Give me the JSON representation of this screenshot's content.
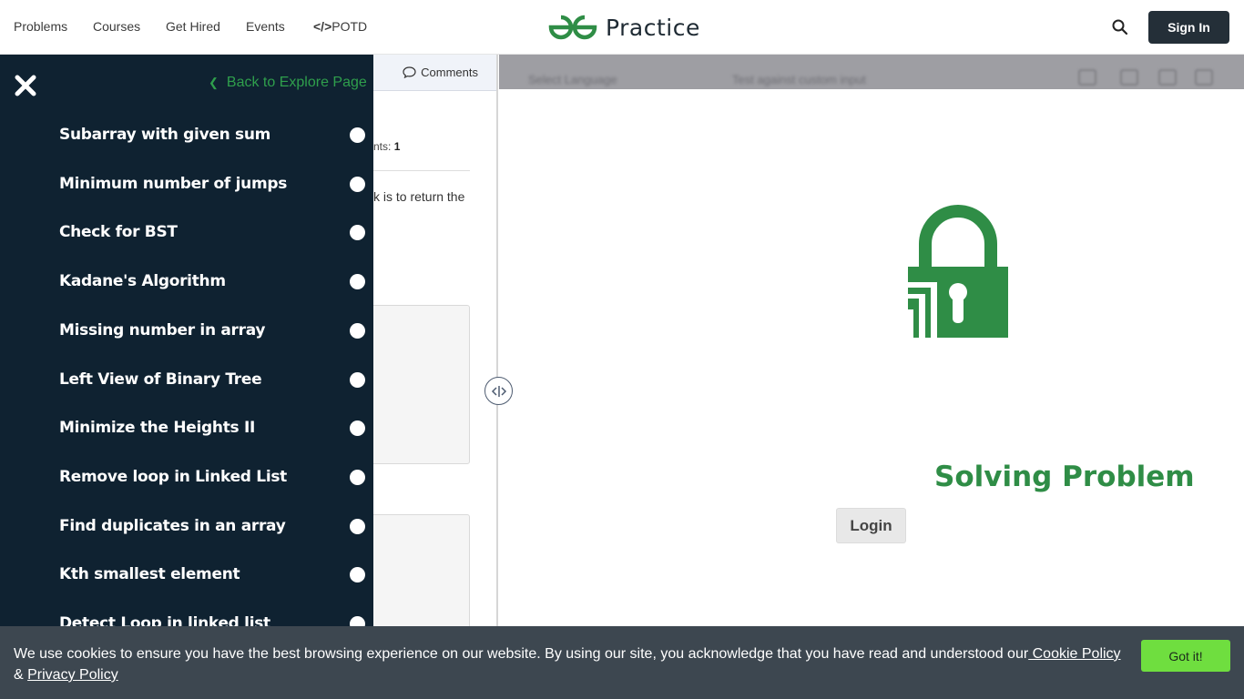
{
  "nav": {
    "links": [
      "Problems",
      "Courses",
      "Get Hired",
      "Events",
      "POTD"
    ],
    "potd_prefix": "</>",
    "logo_text": "Practice",
    "signin_label": "Sign In"
  },
  "problem_panel": {
    "comments_label": "Comments",
    "points_prefix": "nts:",
    "points_value": "1",
    "desc_fragment": "k is to return the"
  },
  "editor": {
    "toolbar_blur_1": "Select Language",
    "toolbar_blur_2": "Test against custom input",
    "lock_title": "Solving Problem",
    "login_label": "Login",
    "accent_color": "#2f8d46"
  },
  "sidebar": {
    "back_label": "Back to Explore Page",
    "problems": [
      "Subarray with given sum",
      "Minimum number of jumps",
      "Check for BST",
      "Kadane's Algorithm",
      "Missing number in array",
      "Left View of Binary Tree",
      "Minimize the Heights II",
      "Remove loop in Linked List",
      "Find duplicates in an array",
      "Kth smallest element",
      "Detect Loop in linked list"
    ]
  },
  "cookie": {
    "text": "We use cookies to ensure you have the best browsing experience on our website. By using our site, you acknowledge that you have read and understood our",
    "cookie_link": " Cookie Policy",
    "ampersand": "& ",
    "privacy_link": "Privacy Policy",
    "button_label": "Got it!",
    "button_color": "#6fde3f"
  }
}
